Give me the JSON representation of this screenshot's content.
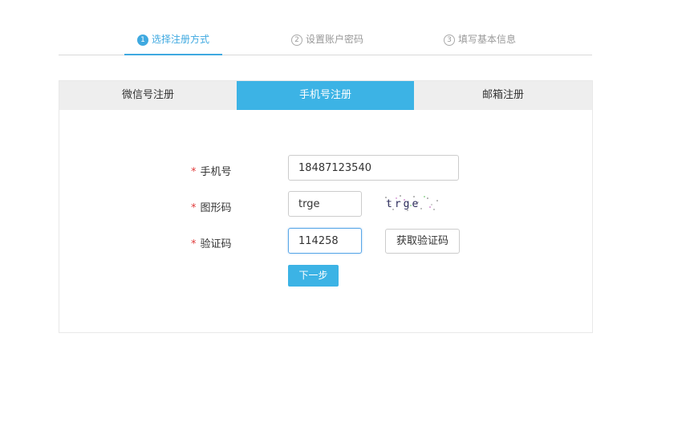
{
  "steps": [
    {
      "num": "1",
      "label": "选择注册方式",
      "active": true
    },
    {
      "num": "2",
      "label": "设置账户密码",
      "active": false
    },
    {
      "num": "3",
      "label": "填写基本信息",
      "active": false
    }
  ],
  "tabs": [
    {
      "label": "微信号注册",
      "active": false
    },
    {
      "label": "手机号注册",
      "active": true
    },
    {
      "label": "邮箱注册",
      "active": false
    }
  ],
  "form": {
    "required_mark": "*",
    "phone": {
      "label": "手机号",
      "value": "18487123540"
    },
    "captcha": {
      "label": "图形码",
      "value": "trge",
      "image_text": "trge"
    },
    "sms_code": {
      "label": "验证码",
      "value": "114258"
    },
    "get_code_button": "获取验证码",
    "next_button": "下一步"
  },
  "colors": {
    "accent": "#3cb3e5",
    "required": "#e03c3c"
  }
}
